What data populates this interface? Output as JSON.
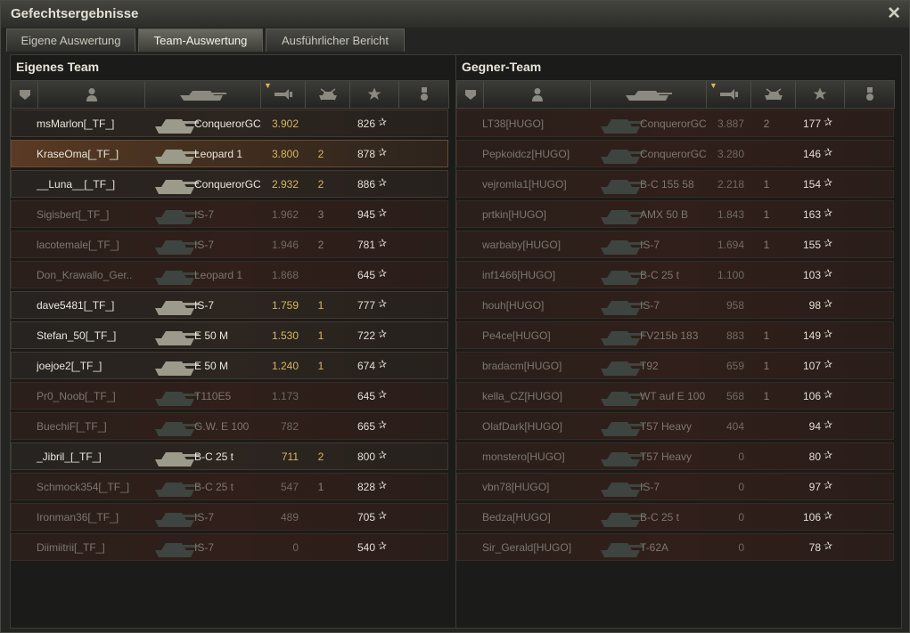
{
  "window": {
    "title": "Gefechtsergebnisse",
    "close_icon": "close-icon"
  },
  "tabs": [
    {
      "label": "Eigene Auswertung",
      "active": false
    },
    {
      "label": "Team-Auswertung",
      "active": true
    },
    {
      "label": "Ausführlicher Bericht",
      "active": false
    }
  ],
  "header_icons": [
    "squad-icon",
    "player-icon",
    "tank-icon",
    "damage-icon",
    "kills-icon",
    "xp-star-icon",
    "medal-icon"
  ],
  "colors": {
    "accent_gold": "#d6b760",
    "alive_text": "#e9e6dc",
    "dead_text": "#7d776f",
    "highlight_row": "#5a3a24"
  },
  "own_team": {
    "title": "Eigenes Team",
    "rows": [
      {
        "player": "msMarlon[_TF_]",
        "vehicle": "ConquerorGC",
        "damage": "3.902",
        "kills": "",
        "xp": "826",
        "alive": true,
        "highlight": false
      },
      {
        "player": "KraseOma[_TF_]",
        "vehicle": "Leopard 1",
        "damage": "3.800",
        "kills": "2",
        "xp": "878",
        "alive": true,
        "highlight": true
      },
      {
        "player": "__Luna__[_TF_]",
        "vehicle": "ConquerorGC",
        "damage": "2.932",
        "kills": "2",
        "xp": "886",
        "alive": true,
        "highlight": false
      },
      {
        "player": "Sigisbert[_TF_]",
        "vehicle": "IS-7",
        "damage": "1.962",
        "kills": "3",
        "xp": "945",
        "alive": false,
        "highlight": false
      },
      {
        "player": "lacotemale[_TF_]",
        "vehicle": "IS-7",
        "damage": "1.946",
        "kills": "2",
        "xp": "781",
        "alive": false,
        "highlight": false
      },
      {
        "player": "Don_Krawallo_Ger..",
        "vehicle": "Leopard 1",
        "damage": "1.868",
        "kills": "",
        "xp": "645",
        "alive": false,
        "highlight": false
      },
      {
        "player": "dave5481[_TF_]",
        "vehicle": "IS-7",
        "damage": "1.759",
        "kills": "1",
        "xp": "777",
        "alive": true,
        "highlight": false
      },
      {
        "player": "Stefan_50[_TF_]",
        "vehicle": "E 50 M",
        "damage": "1.530",
        "kills": "1",
        "xp": "722",
        "alive": true,
        "highlight": false
      },
      {
        "player": "joejoe2[_TF_]",
        "vehicle": "E 50 M",
        "damage": "1.240",
        "kills": "1",
        "xp": "674",
        "alive": true,
        "highlight": false
      },
      {
        "player": "Pr0_Noob[_TF_]",
        "vehicle": "T110E5",
        "damage": "1.173",
        "kills": "",
        "xp": "645",
        "alive": false,
        "highlight": false
      },
      {
        "player": "BuechiF[_TF_]",
        "vehicle": "G.W. E 100",
        "damage": "782",
        "kills": "",
        "xp": "665",
        "alive": false,
        "highlight": false
      },
      {
        "player": "_Jibril_[_TF_]",
        "vehicle": "B-C 25 t",
        "damage": "711",
        "kills": "2",
        "xp": "800",
        "alive": true,
        "highlight": false
      },
      {
        "player": "Schmock354[_TF_]",
        "vehicle": "B-C 25 t",
        "damage": "547",
        "kills": "1",
        "xp": "828",
        "alive": false,
        "highlight": false
      },
      {
        "player": "Ironman36[_TF_]",
        "vehicle": "IS-7",
        "damage": "489",
        "kills": "",
        "xp": "705",
        "alive": false,
        "highlight": false
      },
      {
        "player": "Diimiitrii[_TF_]",
        "vehicle": "IS-7",
        "damage": "0",
        "kills": "",
        "xp": "540",
        "alive": false,
        "highlight": false
      }
    ]
  },
  "enemy_team": {
    "title": "Gegner-Team",
    "rows": [
      {
        "player": "LT38[HUGO]",
        "vehicle": "ConquerorGC",
        "damage": "3.887",
        "kills": "2",
        "xp": "177",
        "alive": false,
        "highlight": false
      },
      {
        "player": "Pepkoidcz[HUGO]",
        "vehicle": "ConquerorGC",
        "damage": "3.280",
        "kills": "",
        "xp": "146",
        "alive": false,
        "highlight": false
      },
      {
        "player": "vejromla1[HUGO]",
        "vehicle": "B-C 155 58",
        "damage": "2.218",
        "kills": "1",
        "xp": "154",
        "alive": false,
        "highlight": false
      },
      {
        "player": "prtkin[HUGO]",
        "vehicle": "AMX 50 B",
        "damage": "1.843",
        "kills": "1",
        "xp": "163",
        "alive": false,
        "highlight": false
      },
      {
        "player": "warbaby[HUGO]",
        "vehicle": "IS-7",
        "damage": "1.694",
        "kills": "1",
        "xp": "155",
        "alive": false,
        "highlight": false
      },
      {
        "player": "inf1466[HUGO]",
        "vehicle": "B-C 25 t",
        "damage": "1.100",
        "kills": "",
        "xp": "103",
        "alive": false,
        "highlight": false
      },
      {
        "player": "houh[HUGO]",
        "vehicle": "IS-7",
        "damage": "958",
        "kills": "",
        "xp": "98",
        "alive": false,
        "highlight": false
      },
      {
        "player": "Pe4ce[HUGO]",
        "vehicle": "FV215b 183",
        "damage": "883",
        "kills": "1",
        "xp": "149",
        "alive": false,
        "highlight": false
      },
      {
        "player": "bradacm[HUGO]",
        "vehicle": "T92",
        "damage": "659",
        "kills": "1",
        "xp": "107",
        "alive": false,
        "highlight": false
      },
      {
        "player": "kella_CZ[HUGO]",
        "vehicle": "WT auf E 100",
        "damage": "568",
        "kills": "1",
        "xp": "106",
        "alive": false,
        "highlight": false
      },
      {
        "player": "OlafDark[HUGO]",
        "vehicle": "T57 Heavy",
        "damage": "404",
        "kills": "",
        "xp": "94",
        "alive": false,
        "highlight": false
      },
      {
        "player": "monstero[HUGO]",
        "vehicle": "T57 Heavy",
        "damage": "0",
        "kills": "",
        "xp": "80",
        "alive": false,
        "highlight": false
      },
      {
        "player": "vbn78[HUGO]",
        "vehicle": "IS-7",
        "damage": "0",
        "kills": "",
        "xp": "97",
        "alive": false,
        "highlight": false
      },
      {
        "player": "Bedza[HUGO]",
        "vehicle": "B-C 25 t",
        "damage": "0",
        "kills": "",
        "xp": "106",
        "alive": false,
        "highlight": false
      },
      {
        "player": "Sir_Gerald[HUGO]",
        "vehicle": "T-62A",
        "damage": "0",
        "kills": "",
        "xp": "78",
        "alive": false,
        "highlight": false
      }
    ]
  }
}
